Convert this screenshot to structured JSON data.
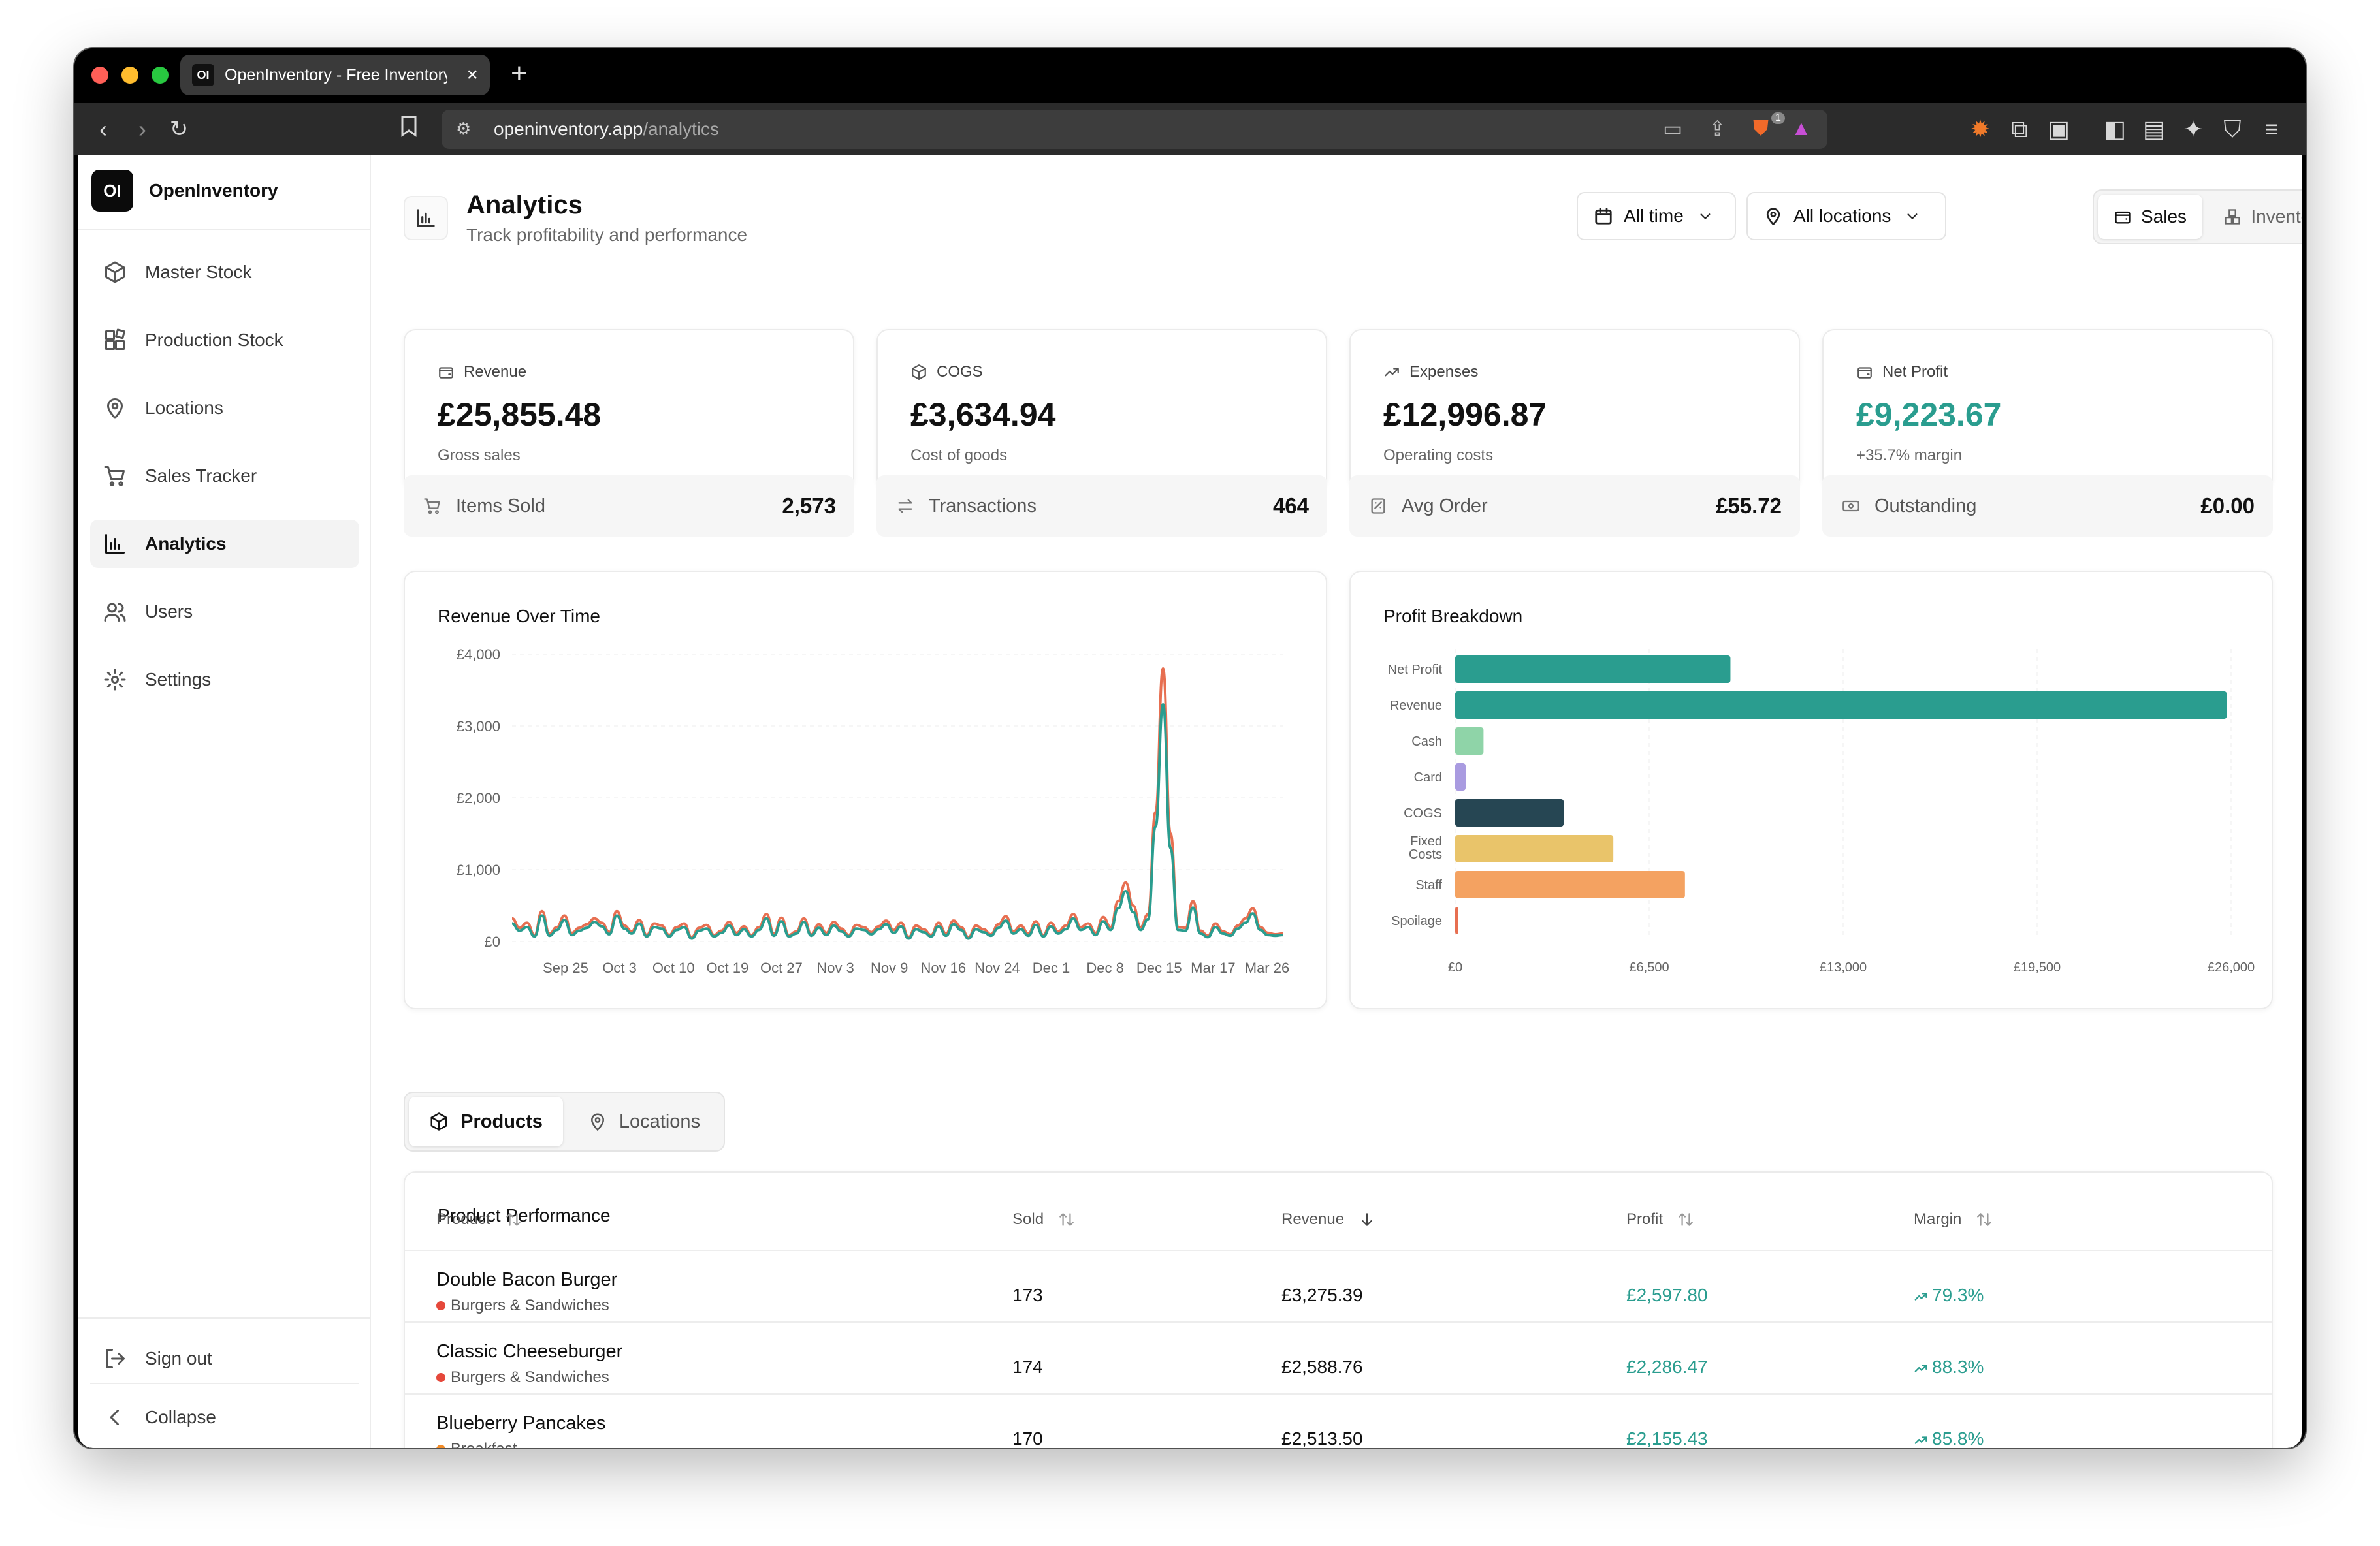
{
  "browser": {
    "tab_title": "OpenInventory - Free Inventory Manager",
    "tab_favicon": "OI",
    "url_host": "openinventory.app",
    "url_path": "/analytics",
    "shield_badge": "1"
  },
  "sidebar": {
    "logo": "OI",
    "brand": "OpenInventory",
    "items": [
      {
        "label": "Master Stock",
        "icon": "box-icon"
      },
      {
        "label": "Production Stock",
        "icon": "blocks-icon"
      },
      {
        "label": "Locations",
        "icon": "map-pin-icon"
      },
      {
        "label": "Sales Tracker",
        "icon": "cart-icon"
      },
      {
        "label": "Analytics",
        "icon": "bar-chart-icon",
        "active": true
      },
      {
        "label": "Users",
        "icon": "users-icon"
      },
      {
        "label": "Settings",
        "icon": "gear-icon"
      }
    ],
    "sign_out": "Sign out",
    "collapse": "Collapse"
  },
  "header": {
    "title": "Analytics",
    "subtitle": "Track profitability and performance",
    "time_filter": "All time",
    "location_filter": "All locations",
    "view_toggle": [
      "Sales",
      "Inventory"
    ],
    "active_view": "Sales"
  },
  "kpis": [
    {
      "label": "Revenue",
      "value": "£25,855.48",
      "sub": "Gross sales"
    },
    {
      "label": "COGS",
      "value": "£3,634.94",
      "sub": "Cost of goods"
    },
    {
      "label": "Expenses",
      "value": "£12,996.87",
      "sub": "Operating costs"
    },
    {
      "label": "Net Profit",
      "value": "£9,223.67",
      "sub": "+35.7% margin"
    }
  ],
  "stats": [
    {
      "label": "Items Sold",
      "value": "2,573"
    },
    {
      "label": "Transactions",
      "value": "464"
    },
    {
      "label": "Avg Order",
      "value": "£55.72"
    },
    {
      "label": "Outstanding",
      "value": "£0.00"
    }
  ],
  "colors": {
    "accent_green": "#2a9d8f",
    "line_orange": "#e76f51",
    "bar_net_profit": "#2a9d8f",
    "bar_revenue": "#2a9d8f",
    "bar_cash": "#8fd4a8",
    "bar_card": "#a99be0",
    "bar_cogs": "#264653",
    "bar_fixed": "#e9c46a",
    "bar_staff": "#f4a261",
    "bar_spoilage": "#e76f51"
  },
  "chart_data": [
    {
      "type": "line",
      "title": "Revenue Over Time",
      "ylim": [
        0,
        4000
      ],
      "yticks": [
        "£0",
        "£1,000",
        "£2,000",
        "£3,000",
        "£4,000"
      ],
      "xticks": [
        "Sep 25",
        "Oct 3",
        "Oct 10",
        "Oct 19",
        "Oct 27",
        "Nov 3",
        "Nov 9",
        "Nov 16",
        "Nov 24",
        "Dec 1",
        "Dec 8",
        "Dec 15",
        "Mar 17",
        "Mar 26"
      ],
      "grid": true,
      "series": [
        {
          "color": "#e76f51",
          "values": [
            320,
            190,
            260,
            90,
            420,
            110,
            200,
            360,
            120,
            190,
            240,
            320,
            260,
            130,
            420,
            220,
            140,
            300,
            90,
            250,
            220,
            90,
            200,
            250,
            60,
            190,
            230,
            90,
            150,
            270,
            120,
            210,
            90,
            200,
            380,
            110,
            330,
            90,
            140,
            320,
            100,
            240,
            120,
            270,
            180,
            90,
            230,
            200,
            130,
            210,
            290,
            160,
            260,
            60,
            220,
            170,
            90,
            260,
            110,
            290,
            200,
            60,
            220,
            170,
            100,
            240,
            350,
            140,
            220,
            110,
            280,
            90,
            260,
            140,
            220,
            380,
            200,
            250,
            120,
            340,
            200,
            560,
            820,
            500,
            200,
            380,
            1800,
            3800,
            1500,
            200,
            190,
            560,
            150,
            80,
            250,
            140,
            100,
            220,
            320,
            460,
            200,
            120,
            100,
            110
          ]
        },
        {
          "color": "#2a9d8f",
          "values": [
            250,
            150,
            200,
            70,
            360,
            80,
            160,
            300,
            90,
            150,
            190,
            270,
            210,
            100,
            360,
            180,
            110,
            250,
            70,
            200,
            180,
            70,
            160,
            200,
            40,
            150,
            180,
            70,
            120,
            220,
            90,
            170,
            70,
            160,
            320,
            80,
            280,
            70,
            110,
            270,
            80,
            190,
            90,
            220,
            140,
            70,
            180,
            160,
            100,
            170,
            240,
            120,
            210,
            40,
            170,
            130,
            70,
            210,
            80,
            240,
            160,
            40,
            170,
            130,
            80,
            190,
            290,
            110,
            170,
            80,
            230,
            70,
            210,
            110,
            170,
            320,
            160,
            200,
            90,
            280,
            160,
            460,
            700,
            410,
            160,
            310,
            1600,
            3300,
            1300,
            160,
            150,
            470,
            110,
            60,
            200,
            110,
            80,
            180,
            260,
            390,
            160,
            90,
            80,
            90
          ]
        }
      ]
    },
    {
      "type": "bar",
      "orientation": "horizontal",
      "title": "Profit Breakdown",
      "categories": [
        "Net Profit",
        "Revenue",
        "Cash",
        "Card",
        "COGS",
        "Fixed Costs",
        "Staff",
        "Spoilage"
      ],
      "values": [
        9223.67,
        25855.48,
        950,
        350,
        3634.94,
        5300,
        7700,
        100
      ],
      "xlim": [
        0,
        26000
      ],
      "xticks": [
        "£0",
        "£6,500",
        "£13,000",
        "£19,500",
        "£26,000"
      ],
      "grid": true
    }
  ],
  "tabs": [
    "Products",
    "Locations"
  ],
  "active_tab": "Products",
  "table": {
    "title": "Product Performance",
    "columns": [
      "Product",
      "Sold",
      "Revenue",
      "Profit",
      "Margin"
    ],
    "rows": [
      {
        "name": "Double Bacon Burger",
        "category": "Burgers & Sandwiches",
        "cat_color": "#e5483b",
        "sold": "173",
        "revenue": "£3,275.39",
        "profit": "£2,597.80",
        "margin": "79.3%"
      },
      {
        "name": "Classic Cheeseburger",
        "category": "Burgers & Sandwiches",
        "cat_color": "#e5483b",
        "sold": "174",
        "revenue": "£2,588.76",
        "profit": "£2,286.47",
        "margin": "88.3%"
      },
      {
        "name": "Blueberry Pancakes",
        "category": "Breakfast",
        "cat_color": "#f28c28",
        "sold": "170",
        "revenue": "£2,513.50",
        "profit": "£2,155.43",
        "margin": "85.8%"
      }
    ]
  }
}
